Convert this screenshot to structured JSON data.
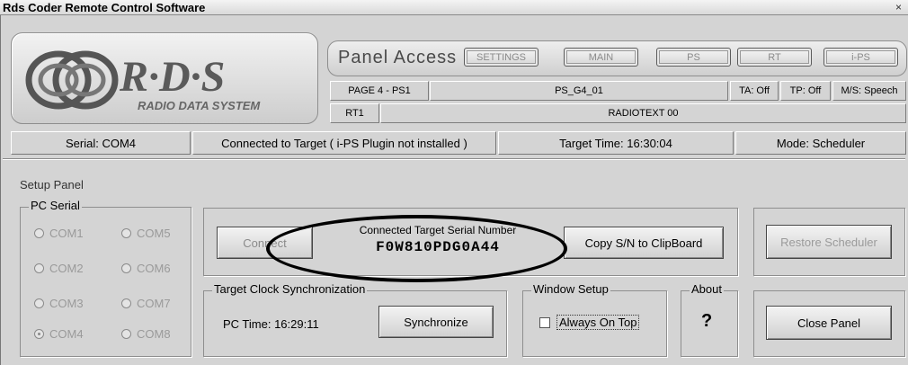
{
  "window": {
    "title": "Rds Coder Remote Control Software",
    "close": "×"
  },
  "logo": {
    "rds": "R·D·S",
    "subtitle": "RADIO DATA SYSTEM"
  },
  "panel_access": {
    "label": "Panel Access",
    "buttons": [
      "SETTINGS",
      "MAIN",
      "PS",
      "RT",
      "i-PS"
    ]
  },
  "fields": {
    "page": "PAGE 4 - PS1",
    "ps": "PS_G4_01",
    "ta": "TA: Off",
    "tp": "TP: Off",
    "ms": "M/S: Speech",
    "rt_label": "RT1",
    "rt_value": "RADIOTEXT 00"
  },
  "status": {
    "serial": "Serial: COM4",
    "connection": "Connected to Target  ( i-PS Plugin not installed )",
    "target_time": "Target Time:  16:30:04",
    "mode": "Mode: Scheduler"
  },
  "setup": {
    "label": "Setup Panel",
    "pc_serial": {
      "title": "PC Serial",
      "ports": [
        "COM1",
        "COM5",
        "COM2",
        "COM6",
        "COM3",
        "COM7",
        "COM4",
        "COM8"
      ],
      "selected": "COM4"
    },
    "connect_label": "Connect",
    "serial_title": "Connected Target Serial Number",
    "serial_value": "F0W810PDG0A44",
    "copy_label": "Copy S/N to ClipBoard",
    "restore_label": "Restore Scheduler",
    "clock": {
      "title": "Target Clock Synchronization",
      "pc_time": "PC Time:  16:29:11",
      "sync_label": "Synchronize"
    },
    "window_setup": {
      "title": "Window Setup",
      "always_on_top": "Always On Top"
    },
    "about": {
      "title": "About",
      "glyph": "?"
    },
    "close_label": "Close Panel"
  }
}
